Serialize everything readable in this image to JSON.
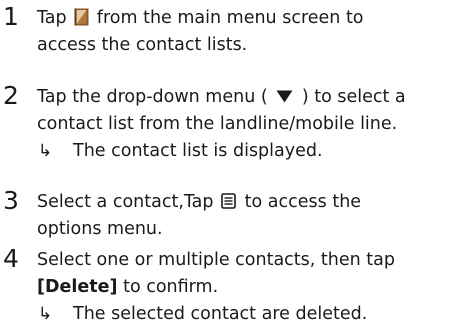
{
  "steps": [
    {
      "number": "1",
      "icon": "contacts-book-icon",
      "lines": [
        "Tap",
        "from the main menu screen to",
        "access the contact lists."
      ]
    },
    {
      "number": "2",
      "icon": "dropdown-triangle-icon",
      "lines": [
        "Tap the drop-down menu (",
        ") to select a",
        "contact list from the landline/mobile line."
      ],
      "result": "The contact list is displayed."
    },
    {
      "number": "3",
      "icon": "options-menu-icon",
      "lines": [
        "Select a contact,Tap",
        "to access the",
        "options menu."
      ]
    },
    {
      "number": "4",
      "lines": [
        "Select one or multiple contacts, then tap",
        "[Delete]",
        "to confirm."
      ],
      "result": "The selected contact are deleted."
    }
  ],
  "result_arrow": "↳",
  "colors": {
    "text": "#1a1a1a",
    "contacts_icon_brown": "#8a5a2b",
    "contacts_icon_light": "#e6c8a0"
  }
}
